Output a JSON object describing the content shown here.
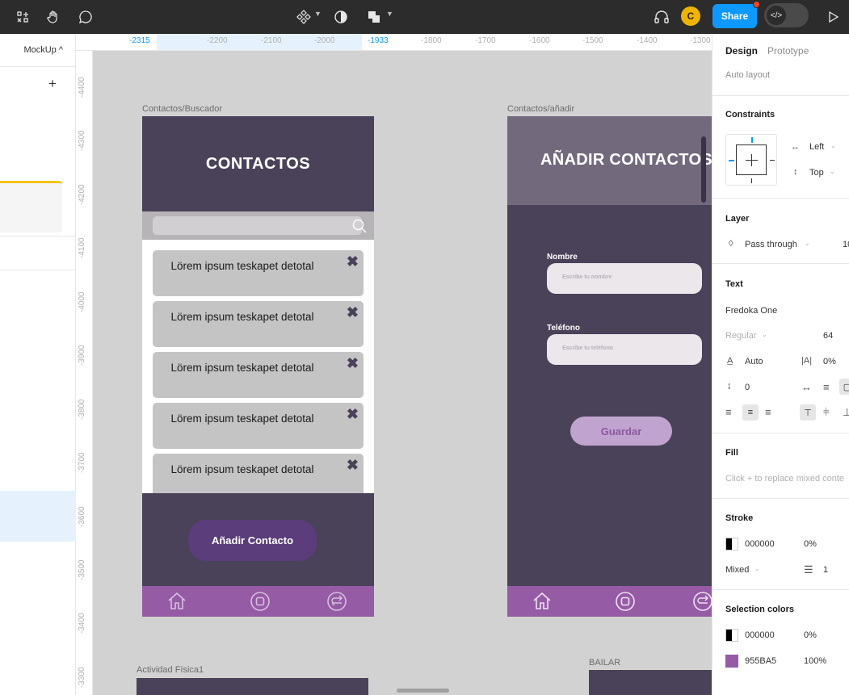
{
  "toolbar": {
    "share_label": "Share",
    "avatar_initial": "C"
  },
  "left_panel": {
    "page_name": "MockUp ^"
  },
  "ruler": {
    "x_ticks": [
      "-2315",
      "-2200",
      "-2100",
      "-2000",
      "-1933",
      "-1800",
      "-1700",
      "-1600",
      "-1500",
      "-1400",
      "-1300"
    ],
    "y_ticks": [
      "-4400",
      "-4300",
      "-4200",
      "-4100",
      "-4000",
      "-3900",
      "-3800",
      "-3700",
      "-3600",
      "-3500",
      "-3400",
      "-3300"
    ]
  },
  "canvas": {
    "frame1": {
      "label": "Contactos/Buscador",
      "title": "CONTACTOS",
      "items": [
        "Lörem ipsum teskapet detotal",
        "Lörem ipsum teskapet detotal",
        "Lörem ipsum teskapet detotal",
        "Lörem ipsum teskapet detotal",
        "Lörem ipsum teskapet detotal"
      ],
      "remove_glyph": "✖",
      "add_button": "Añadir Contacto"
    },
    "frame2": {
      "label": "Contactos/añadir",
      "title": "AÑADIR CONTACTOS",
      "name_label": "Nombre",
      "name_placeholder": "Escribe tu   nombre",
      "phone_label": "Teléfono",
      "phone_placeholder": "Escribe tu teléfono",
      "save_button": "Guardar"
    },
    "frame3": {
      "label": "Actividad Física1"
    },
    "frame4": {
      "label": "BAILAR"
    }
  },
  "right_panel": {
    "tabs": [
      "Design",
      "Prototype"
    ],
    "auto_layout": "Auto layout",
    "constraints": {
      "title": "Constraints",
      "horizontal": "Left",
      "vertical": "Top"
    },
    "layer": {
      "title": "Layer",
      "blend": "Pass through",
      "opacity": "10"
    },
    "text": {
      "title": "Text",
      "font": "Fredoka One",
      "weight": "Regular",
      "size": "64",
      "line_height": "Auto",
      "letter_spacing": "0%",
      "paragraph_spacing": "0"
    },
    "fill": {
      "title": "Fill",
      "hint": "Click + to replace mixed conte"
    },
    "stroke": {
      "title": "Stroke",
      "color": "000000",
      "opacity": "0%",
      "position": "Mixed",
      "weight": "1"
    },
    "selection_colors": {
      "title": "Selection colors",
      "colors": [
        {
          "hex": "000000",
          "opacity": "0%"
        },
        {
          "hex": "955BA5",
          "opacity": "100%"
        }
      ]
    }
  },
  "colors": {
    "frame_dark": "#4a4259",
    "nav_purple": "#955ba5",
    "accent_blue": "#0d99ff"
  }
}
